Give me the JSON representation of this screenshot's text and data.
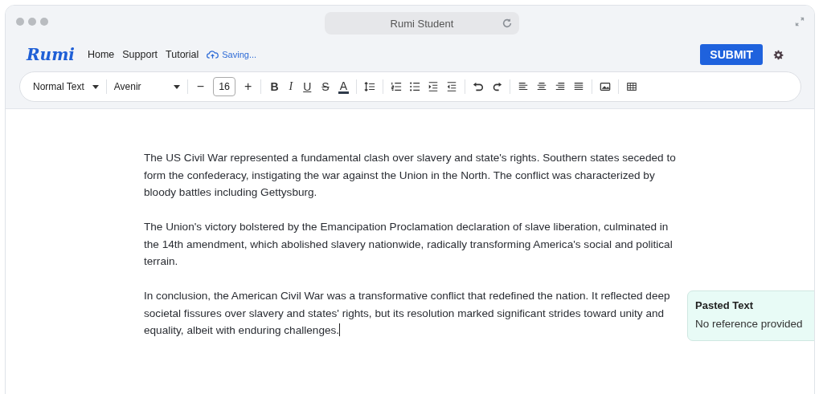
{
  "window": {
    "title": "Rumi Student"
  },
  "nav": {
    "logo": "Rumi",
    "links": [
      "Home",
      "Support",
      "Tutorial"
    ],
    "status": "Saving...",
    "submit": "SUBMIT"
  },
  "toolbar": {
    "style": "Normal Text",
    "font": "Avenir",
    "decrease": "−",
    "size": "16",
    "increase": "+",
    "format_buttons": [
      {
        "kind": "bold",
        "label": "B"
      },
      {
        "kind": "italic",
        "label": "I"
      },
      {
        "kind": "underline",
        "label": "U"
      },
      {
        "kind": "strike",
        "label": "S"
      },
      {
        "kind": "color",
        "label": "A"
      }
    ]
  },
  "document": {
    "paragraphs": [
      "The US Civil War represented a fundamental clash over slavery and state's rights. Southern states seceded to form the confederacy, instigating the war against the Union in the North. The conflict was characterized by bloody battles including Gettysburg.",
      "The Union's victory bolstered by the Emancipation Proclamation declaration of slave liberation, culminated in the 14th amendment, which abolished slavery nationwide, radically transforming America's social and political terrain.",
      "In conclusion, the American Civil War was a transformative conflict that redefined the nation. It reflected deep societal fissures over slavery and states' rights, but its resolution marked significant strides toward unity and equality, albeit with enduring challenges."
    ]
  },
  "source_note": {
    "title": "Pasted Text",
    "text": "No reference provided"
  }
}
